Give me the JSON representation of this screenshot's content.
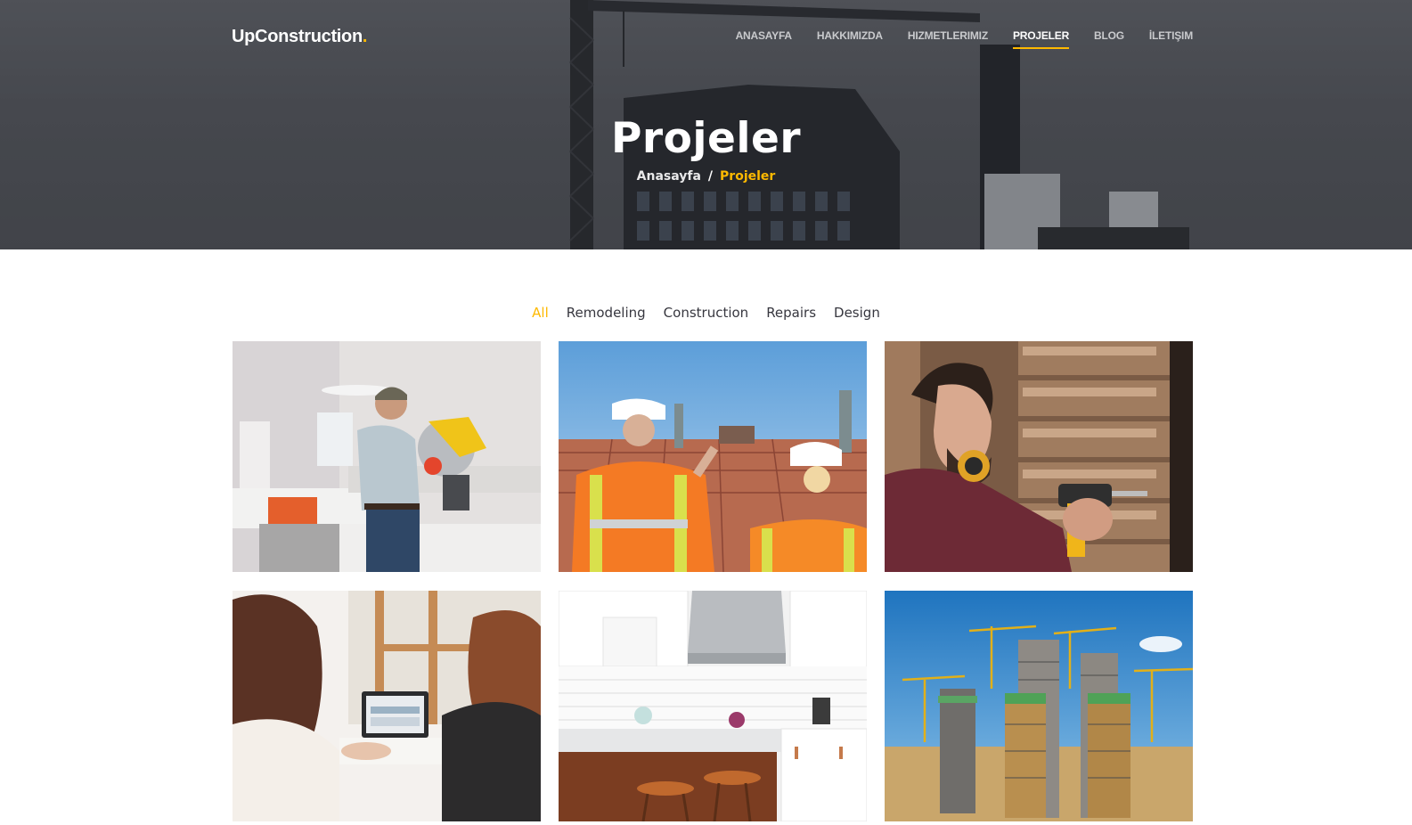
{
  "brand": {
    "name": "UpConstruction",
    "dot": ".",
    "accent": "#feb900"
  },
  "nav": {
    "items": [
      {
        "label": "ANASAYFA",
        "active": false
      },
      {
        "label": "HAKKIMIZDA",
        "active": false
      },
      {
        "label": "HIZMETLERIMIZ",
        "active": false
      },
      {
        "label": "PROJELER",
        "active": true
      },
      {
        "label": "BLOG",
        "active": false
      },
      {
        "label": "İLETIŞIM",
        "active": false
      }
    ]
  },
  "hero": {
    "title": "Projeler",
    "breadcrumb": {
      "home": "Anasayfa",
      "separator": "/",
      "current": "Projeler"
    }
  },
  "filters": [
    "All",
    "Remodeling",
    "Construction",
    "Repairs",
    "Design"
  ],
  "projects": [
    {
      "icon": "workers-saw-image"
    },
    {
      "icon": "site-inspection-image"
    },
    {
      "icon": "carpenter-drill-image"
    },
    {
      "icon": "design-meeting-image"
    },
    {
      "icon": "kitchen-remodel-image"
    },
    {
      "icon": "towers-under-construction-image"
    }
  ]
}
